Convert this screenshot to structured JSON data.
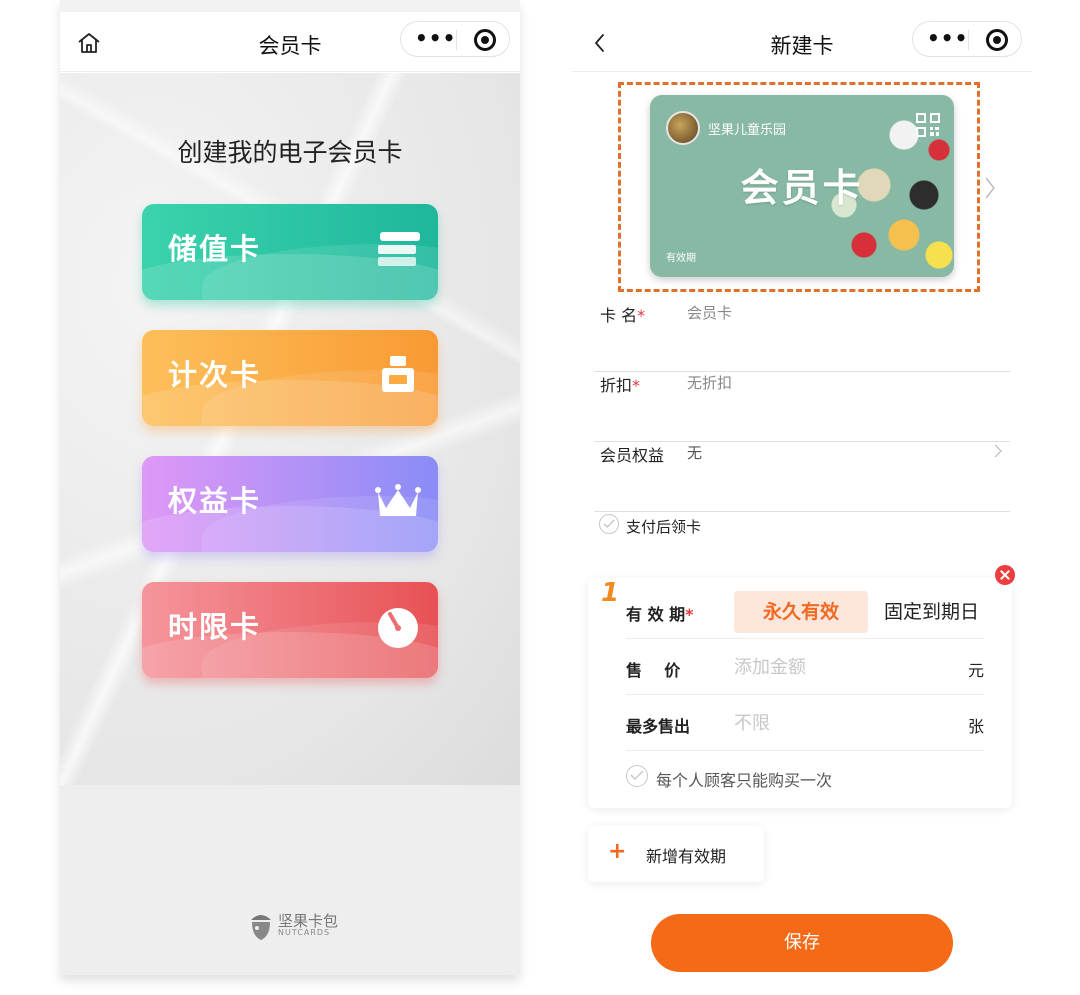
{
  "left_screen": {
    "nav": {
      "title": "会员卡",
      "more": "•••"
    },
    "heading": "创建我的电子会员卡",
    "cards": [
      {
        "label": "储值卡",
        "icon": "stacked-cards-icon"
      },
      {
        "label": "计次卡",
        "icon": "stamp-icon"
      },
      {
        "label": "权益卡",
        "icon": "crown-icon"
      },
      {
        "label": "时限卡",
        "icon": "timer-icon"
      }
    ],
    "brand": {
      "name": "坚果卡包",
      "sub": "NUTCARDS"
    }
  },
  "right_screen": {
    "nav": {
      "title": "新建卡",
      "more": "•••"
    },
    "card_preview": {
      "shop_name": "坚果儿童乐园",
      "card_title": "会员卡",
      "validity_label": "有效期"
    },
    "fields": {
      "card_name": {
        "label": "卡  名",
        "required": "*",
        "value": "会员卡"
      },
      "discount": {
        "label": "折扣",
        "required": "*",
        "value": "无折扣"
      },
      "benefits": {
        "label": "会员权益",
        "value": "无"
      }
    },
    "pay_then_claim": "支付后领卡",
    "period": {
      "index": "1",
      "validity_label": "有 效 期",
      "required": "*",
      "option_permanent": "永久有效",
      "option_fixed": "固定到期日",
      "price_label": "售    价",
      "price_placeholder": "添加金额",
      "price_unit": "元",
      "max_sale_label": "最多售出",
      "max_sale_placeholder": "不限",
      "max_sale_unit": "张",
      "once_per_customer": "每个人顾客只能购买一次"
    },
    "add_period": {
      "plus": "+",
      "label": "新增有效期"
    },
    "save_button": "保存"
  },
  "colors": {
    "accent_orange": "#f56a16",
    "store_card": "#2ec6a2",
    "count_card": "#fbaa46",
    "rights_card": "#b191f6",
    "time_card": "#ec6d72",
    "required_star": "#e03a3a"
  }
}
